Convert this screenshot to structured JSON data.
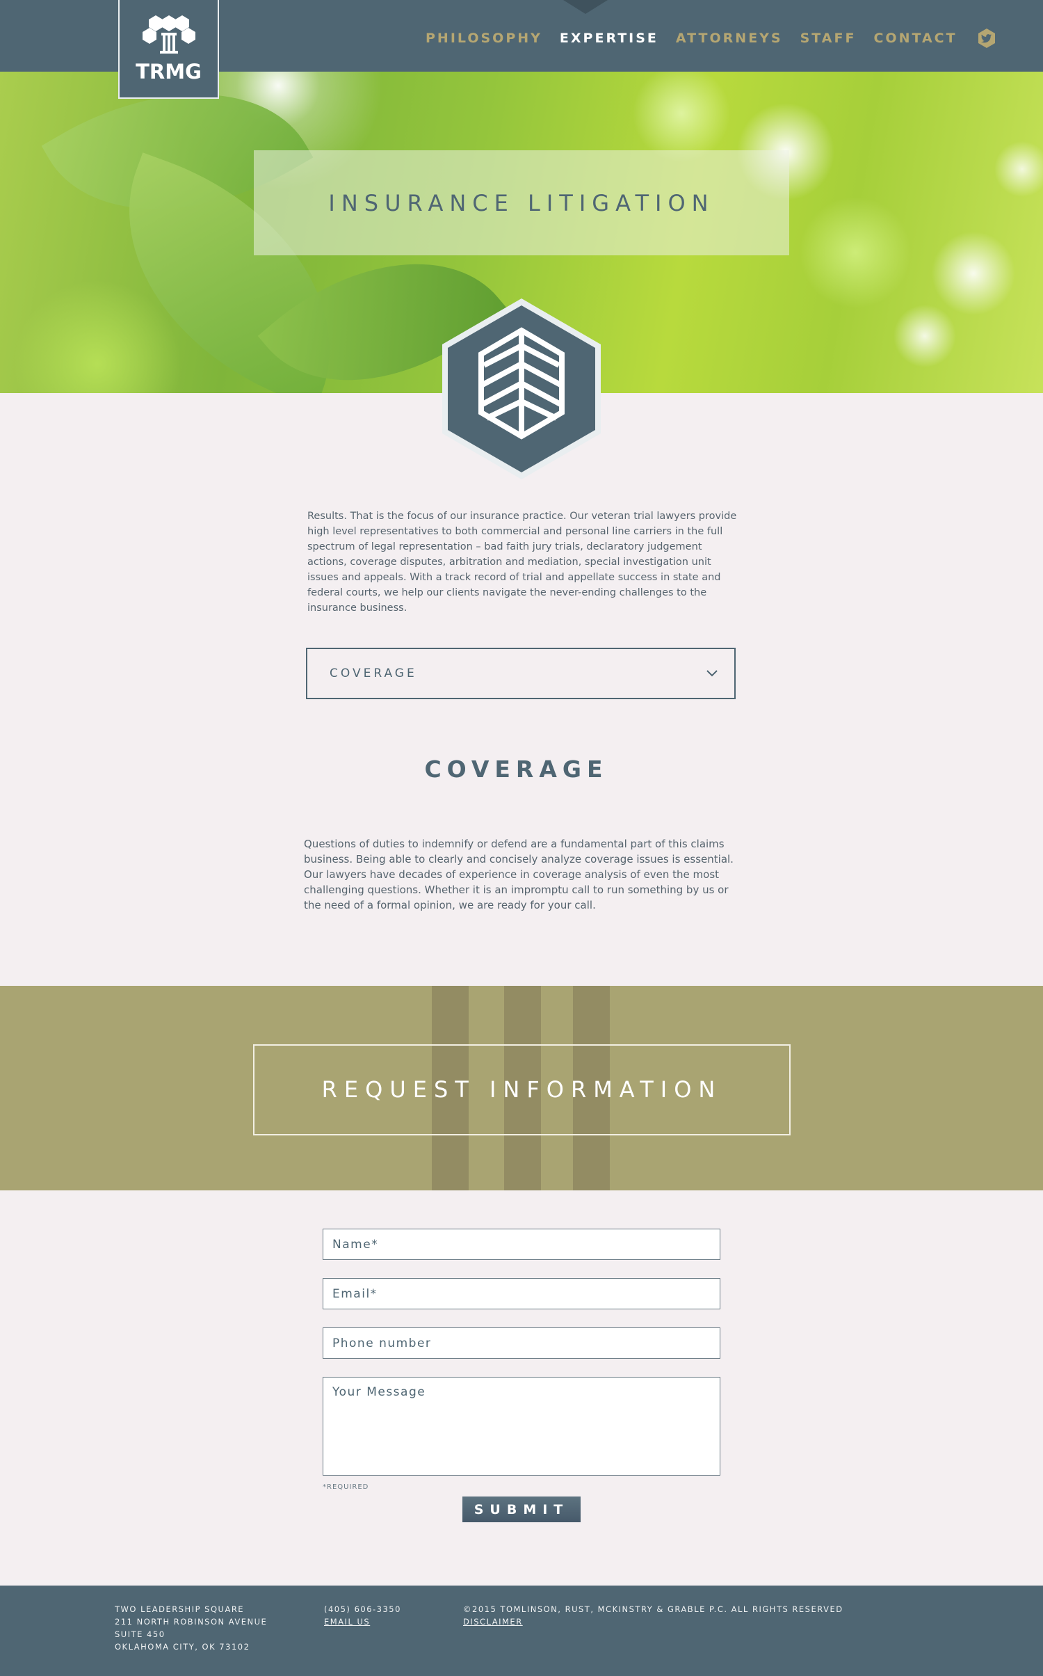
{
  "nav": {
    "logo_text": "TRMG",
    "items": [
      {
        "label": "PHILOSOPHY",
        "active": false
      },
      {
        "label": "EXPERTISE",
        "active": true
      },
      {
        "label": "ATTORNEYS",
        "active": false
      },
      {
        "label": "STAFF",
        "active": false
      },
      {
        "label": "CONTACT",
        "active": false
      }
    ],
    "social_icon": "twitter-icon"
  },
  "hero": {
    "title": "INSURANCE LITIGATION",
    "emblem_icon": "leaf-hexagon-icon"
  },
  "intro": {
    "text": "Results.  That is the focus of our insurance practice.  Our veteran trial lawyers provide high level representatives to both commercial and personal line carriers in the full spectrum of legal representation – bad faith jury trials, declaratory judgement actions, coverage disputes, arbitration and mediation, special investigation unit issues and appeals.  With a track record of trial and appellate success in state and federal courts, we help our clients navigate the never-ending challenges to the insurance business."
  },
  "dropdown": {
    "selected": "COVERAGE",
    "icon": "chevron-down-icon"
  },
  "section": {
    "title": "COVERAGE",
    "text": "Questions of duties to indemnify or defend are a fundamental part of this claims business.  Being able to clearly and concisely analyze coverage issues is essential.  Our lawyers have decades of experience in coverage analysis of even the most challenging questions.  Whether it is an impromptu call to run something by us or the need of a formal opinion, we are ready for your call."
  },
  "request": {
    "title": "REQUEST INFORMATION"
  },
  "form": {
    "name_placeholder": "Name*",
    "email_placeholder": "Email*",
    "phone_placeholder": "Phone number",
    "message_placeholder": "Your Message",
    "required_note": "*REQUIRED",
    "submit_label": "SUBMIT"
  },
  "footer": {
    "address": [
      "TWO LEADERSHIP SQUARE",
      "211 NORTH ROBINSON AVENUE",
      "SUITE 450",
      "OKLAHOMA CITY, OK 73102"
    ],
    "phone": "(405) 606-3350",
    "email_link": "EMAIL US",
    "copyright": "©2015 TOMLINSON, RUST, MCKINSTRY & GRABLE P.C. ALL RIGHTS RESERVED",
    "disclaimer_link": "DISCLAIMER"
  },
  "colors": {
    "nav_bg": "#4f6673",
    "nav_text": "#b5a672",
    "page_bg": "#f4eff1",
    "request_bg": "#a9a472"
  }
}
